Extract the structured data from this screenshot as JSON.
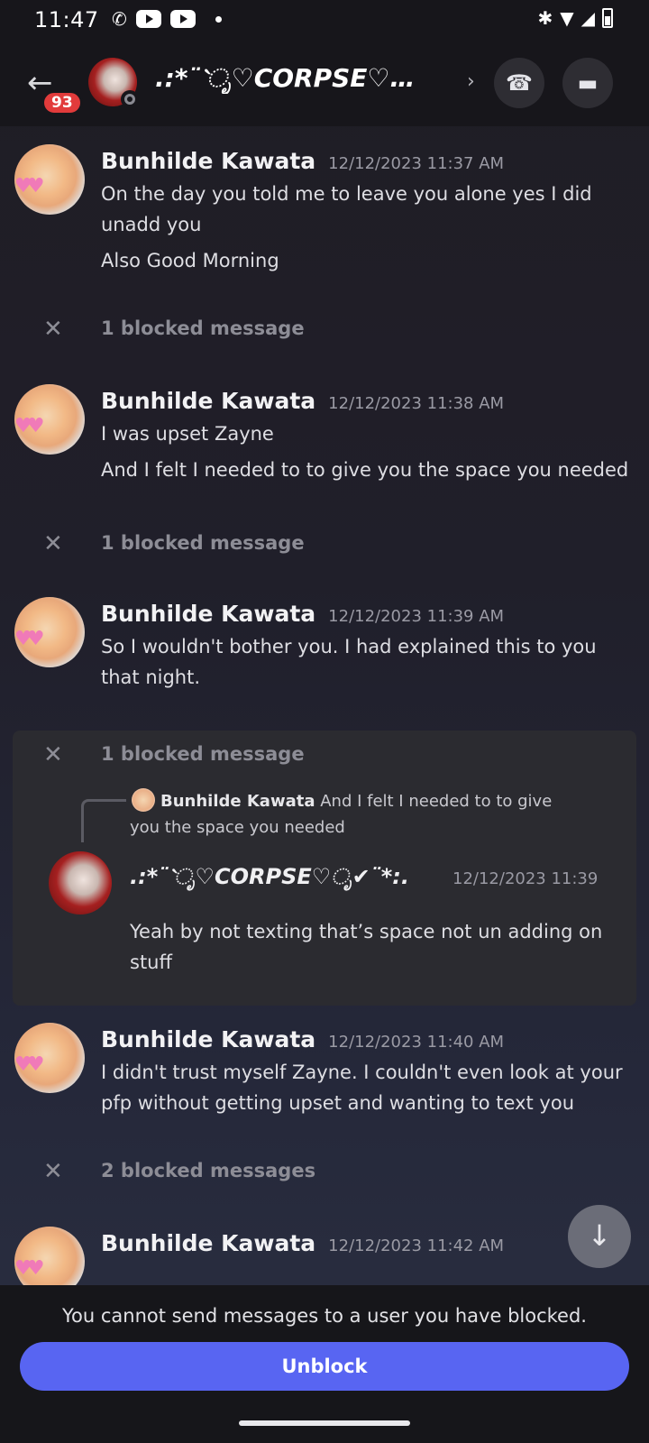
{
  "status_bar": {
    "time": "11:47"
  },
  "header": {
    "unread_badge": "93",
    "title": ".:*¨`ೃ♡CORPSE♡…",
    "colors": {
      "background": "#17161b",
      "badge": "#e23b3b"
    }
  },
  "messages": [
    {
      "author": "Bunhilde Kawata",
      "timestamp": "12/12/2023 11:37 AM",
      "lines": [
        "On the day you told me to leave you alone yes I did unadd you",
        "Also Good Morning"
      ]
    },
    {
      "author": "Bunhilde Kawata",
      "timestamp": "12/12/2023 11:38 AM",
      "lines": [
        "I was upset Zayne",
        "And I felt I needed to to give you the space you needed"
      ]
    },
    {
      "author": "Bunhilde Kawata",
      "timestamp": "12/12/2023 11:39 AM",
      "lines": [
        "So I wouldn't bother you. I had explained this to you that night."
      ]
    },
    {
      "author": "Bunhilde Kawata",
      "timestamp": "12/12/2023 11:40 AM",
      "lines": [
        "I didn't trust myself Zayne. I couldn't even look at your pfp without getting upset and wanting to text you"
      ]
    },
    {
      "author": "Bunhilde Kawata",
      "timestamp": "12/12/2023 11:42 AM",
      "lines": []
    }
  ],
  "blocked_notices": [
    "1 blocked message",
    "1 blocked message",
    "1 blocked message",
    "2 blocked messages"
  ],
  "revealed_blocked": {
    "reply_author": "Bunhilde Kawata",
    "reply_text": "And I felt I needed to to give you the space you needed",
    "author": ".:*¨`ೃ♡CORPSE♡ೃ✔¨*:.",
    "timestamp": "12/12/2023 11:39",
    "text": "Yeah by not texting that’s space not un adding on stuff"
  },
  "footer": {
    "note": "You cannot send messages to a user you have blocked.",
    "unblock_label": "Unblock",
    "colors": {
      "button": "#5865f2"
    }
  }
}
